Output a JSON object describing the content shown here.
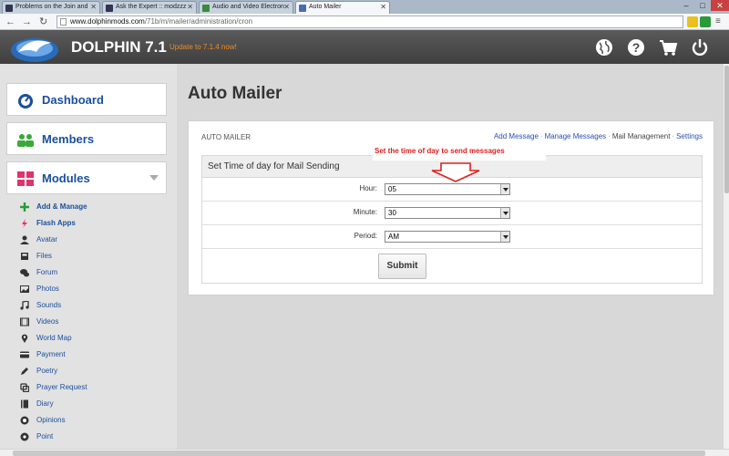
{
  "browser": {
    "tabs": [
      {
        "title": "Problems on the Join and",
        "active": false
      },
      {
        "title": "Ask the Expert :: modzzz",
        "active": false
      },
      {
        "title": "Audio and Video Electron",
        "active": false
      },
      {
        "title": "Auto Mailer",
        "active": true
      }
    ],
    "url_domain": "www.dolphinmods.com",
    "url_path": "/71b/m/mailer/administration/cron",
    "window_controls": [
      "–",
      "□",
      "✕"
    ]
  },
  "header": {
    "brand": "DOLPHIN 7.1",
    "update_notice": "Update to 7.1.4 now!",
    "icons": [
      "globe-icon",
      "help-icon",
      "cart-icon",
      "power-icon"
    ]
  },
  "sidebar": {
    "sections": [
      {
        "label": "Dashboard",
        "icon": "dashboard-icon",
        "color": "#1b4f9c"
      },
      {
        "label": "Members",
        "icon": "members-icon",
        "color": "#3aa83a"
      },
      {
        "label": "Modules",
        "icon": "modules-icon",
        "color": "#e0336c"
      }
    ],
    "module_items": [
      {
        "label": "Add & Manage",
        "icon": "plus-icon",
        "bold": true
      },
      {
        "label": "Flash Apps",
        "icon": "flash-icon",
        "bold": true
      },
      {
        "label": "Avatar",
        "icon": "avatar-icon",
        "bold": false
      },
      {
        "label": "Files",
        "icon": "files-icon",
        "bold": false
      },
      {
        "label": "Forum",
        "icon": "forum-icon",
        "bold": false
      },
      {
        "label": "Photos",
        "icon": "photos-icon",
        "bold": false
      },
      {
        "label": "Sounds",
        "icon": "sounds-icon",
        "bold": false
      },
      {
        "label": "Videos",
        "icon": "videos-icon",
        "bold": false
      },
      {
        "label": "World Map",
        "icon": "map-pin-icon",
        "bold": false
      },
      {
        "label": "Payment",
        "icon": "payment-icon",
        "bold": false
      },
      {
        "label": "Poetry",
        "icon": "pen-icon",
        "bold": false
      },
      {
        "label": "Prayer Request",
        "icon": "prayer-icon",
        "bold": false
      },
      {
        "label": "Diary",
        "icon": "diary-icon",
        "bold": false
      },
      {
        "label": "Opinions",
        "icon": "opinions-icon",
        "bold": false
      },
      {
        "label": "Point",
        "icon": "point-icon",
        "bold": false
      }
    ]
  },
  "main": {
    "page_title": "Auto Mailer",
    "panel_title": "AUTO MAILER",
    "links": [
      "Add Message",
      "Manage Messages",
      "Mail Management",
      "Settings"
    ],
    "current_link": "Mail Management",
    "annotation": "Set the time of day to send messages",
    "form": {
      "heading": "Set Time of day for Mail Sending",
      "fields": [
        {
          "label": "Hour:",
          "value": "05"
        },
        {
          "label": "Minute:",
          "value": "30"
        },
        {
          "label": "Period:",
          "value": "AM"
        }
      ],
      "submit_label": "Submit"
    }
  },
  "colors": {
    "header_bg": "#4a4a4a",
    "link": "#2b4fb0",
    "annotation": "#e02020",
    "update": "#f08a24"
  }
}
